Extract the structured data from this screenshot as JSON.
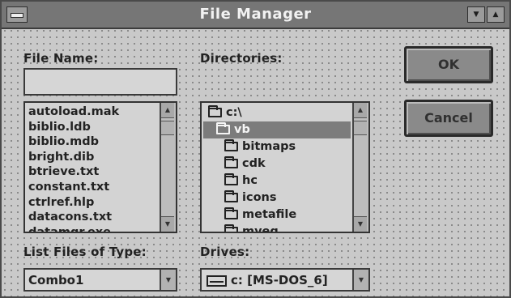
{
  "window": {
    "title": "File Manager",
    "minimize_icon": "triangle-down",
    "maximize_icon": "triangle-up"
  },
  "file_name": {
    "label": "File Name:",
    "value": ""
  },
  "files": {
    "items": [
      "autoload.mak",
      "biblio.ldb",
      "biblio.mdb",
      "bright.dib",
      "btrieve.txt",
      "constant.txt",
      "ctrlref.hlp",
      "datacons.txt",
      "datamgr.exe"
    ]
  },
  "directories": {
    "label": "Directories:",
    "items": [
      {
        "name": "c:\\",
        "icon": "folder-open-icon",
        "level": 0,
        "selected": false
      },
      {
        "name": "vb",
        "icon": "folder-open-icon",
        "level": 1,
        "selected": true
      },
      {
        "name": "bitmaps",
        "icon": "folder-icon",
        "level": 2,
        "selected": false
      },
      {
        "name": "cdk",
        "icon": "folder-icon",
        "level": 2,
        "selected": false
      },
      {
        "name": "hc",
        "icon": "folder-icon",
        "level": 2,
        "selected": false
      },
      {
        "name": "icons",
        "icon": "folder-icon",
        "level": 2,
        "selected": false
      },
      {
        "name": "metafile",
        "icon": "folder-icon",
        "level": 2,
        "selected": false
      },
      {
        "name": "myeg",
        "icon": "folder-icon",
        "level": 2,
        "selected": false
      }
    ]
  },
  "buttons": {
    "ok": "OK",
    "cancel": "Cancel"
  },
  "file_type": {
    "label": "List Files of Type:",
    "value": "Combo1"
  },
  "drives": {
    "label": "Drives:",
    "value": "c: [MS-DOS_6]"
  },
  "colors": {
    "form_background": "#c9c9c9",
    "title_bar": "#767676",
    "selection": "#7c7c7c"
  }
}
